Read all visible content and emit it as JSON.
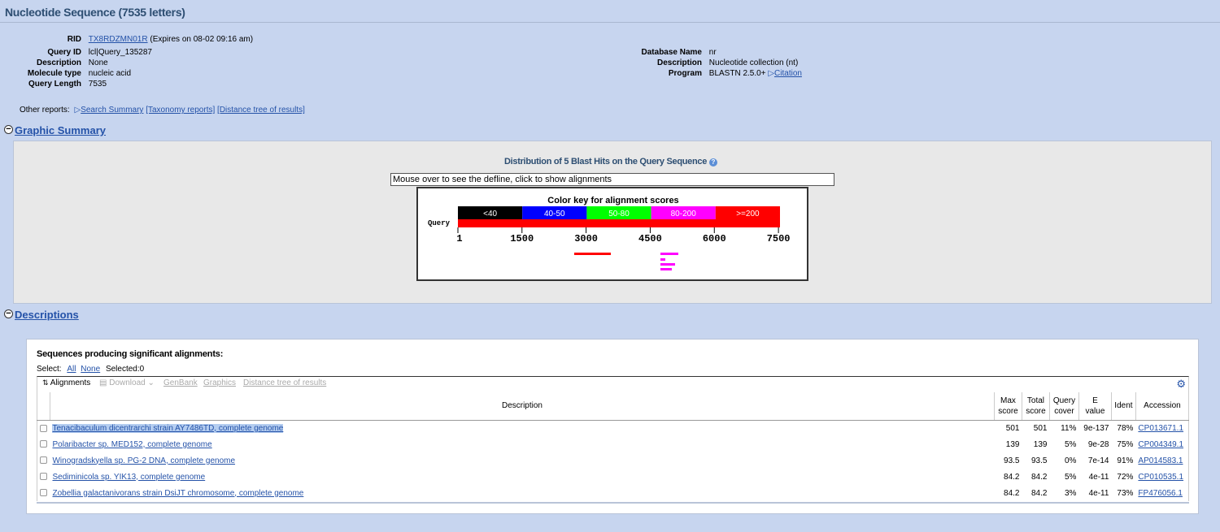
{
  "page": {
    "title": "Nucleotide Sequence (7535 letters)"
  },
  "job": {
    "rid_label": "RID",
    "rid": "TX8RDZMN01R",
    "expires": "(Expires on 08-02 09:16 am)",
    "left": [
      {
        "label": "Query ID",
        "value": "lcl|Query_135287"
      },
      {
        "label": "Description",
        "value": "None"
      },
      {
        "label": "Molecule type",
        "value": "nucleic acid"
      },
      {
        "label": "Query Length",
        "value": "7535"
      }
    ],
    "right": [
      {
        "label": "Database Name",
        "value": "nr"
      },
      {
        "label": "Description",
        "value": "Nucleotide collection (nt)"
      },
      {
        "label": "Program",
        "value": "BLASTN 2.5.0+"
      }
    ],
    "citation_link": "Citation"
  },
  "other_reports": {
    "label": "Other reports:",
    "search_summary": "Search Summary",
    "taxonomy": "[Taxonomy reports]",
    "distance_tree": "[Distance tree of results]"
  },
  "graphic": {
    "section_title": "Graphic Summary",
    "heading": "Distribution of 5 Blast Hits on the Query Sequence",
    "defline": "Mouse over to see the defline, click to show alignments",
    "color_key_title": "Color key for alignment scores",
    "query_label": "Query",
    "key": [
      {
        "label": "<40",
        "color": "#000000"
      },
      {
        "label": "40-50",
        "color": "#0000ff"
      },
      {
        "label": "50-80",
        "color": "#00ff00"
      },
      {
        "label": "80-200",
        "color": "#ff00ff"
      },
      {
        "label": ">=200",
        "color": "#ff0000"
      }
    ],
    "ticks": [
      "1",
      "1500",
      "3000",
      "4500",
      "6000",
      "7500"
    ]
  },
  "descriptions": {
    "section_title": "Descriptions",
    "heading": "Sequences producing significant alignments:",
    "select_label": "Select:",
    "all": "All",
    "none": "None",
    "selected": "Selected:0",
    "toolbar": {
      "alignments": "Alignments",
      "download": "Download",
      "genbank": "GenBank",
      "graphics": "Graphics",
      "distance_tree": "Distance tree of results"
    },
    "columns": {
      "description": "Description",
      "max_score": [
        "Max",
        "score"
      ],
      "total_score": [
        "Total",
        "score"
      ],
      "query_cover": [
        "Query",
        "cover"
      ],
      "e_value": [
        "E",
        "value"
      ],
      "ident": "Ident",
      "accession": "Accession"
    },
    "rows": [
      {
        "description": "Tenacibaculum dicentrarchi strain AY7486TD, complete genome",
        "max": "501",
        "total": "501",
        "cover": "11%",
        "evalue": "9e-137",
        "ident": "78%",
        "accession": "CP013671.1",
        "highlight": true
      },
      {
        "description": "Polaribacter sp. MED152, complete genome",
        "max": "139",
        "total": "139",
        "cover": "5%",
        "evalue": "9e-28",
        "ident": "75%",
        "accession": "CP004349.1"
      },
      {
        "description": "Winogradskyella sp. PG-2 DNA, complete genome",
        "max": "93.5",
        "total": "93.5",
        "cover": "0%",
        "evalue": "7e-14",
        "ident": "91%",
        "accession": "AP014583.1"
      },
      {
        "description": "Sediminicola sp. YIK13, complete genome",
        "max": "84.2",
        "total": "84.2",
        "cover": "5%",
        "evalue": "4e-11",
        "ident": "72%",
        "accession": "CP010535.1"
      },
      {
        "description": "Zobellia galactanivorans strain DsiJT chromosome, complete genome",
        "max": "84.2",
        "total": "84.2",
        "cover": "3%",
        "evalue": "4e-11",
        "ident": "73%",
        "accession": "FP476056.1"
      }
    ]
  }
}
